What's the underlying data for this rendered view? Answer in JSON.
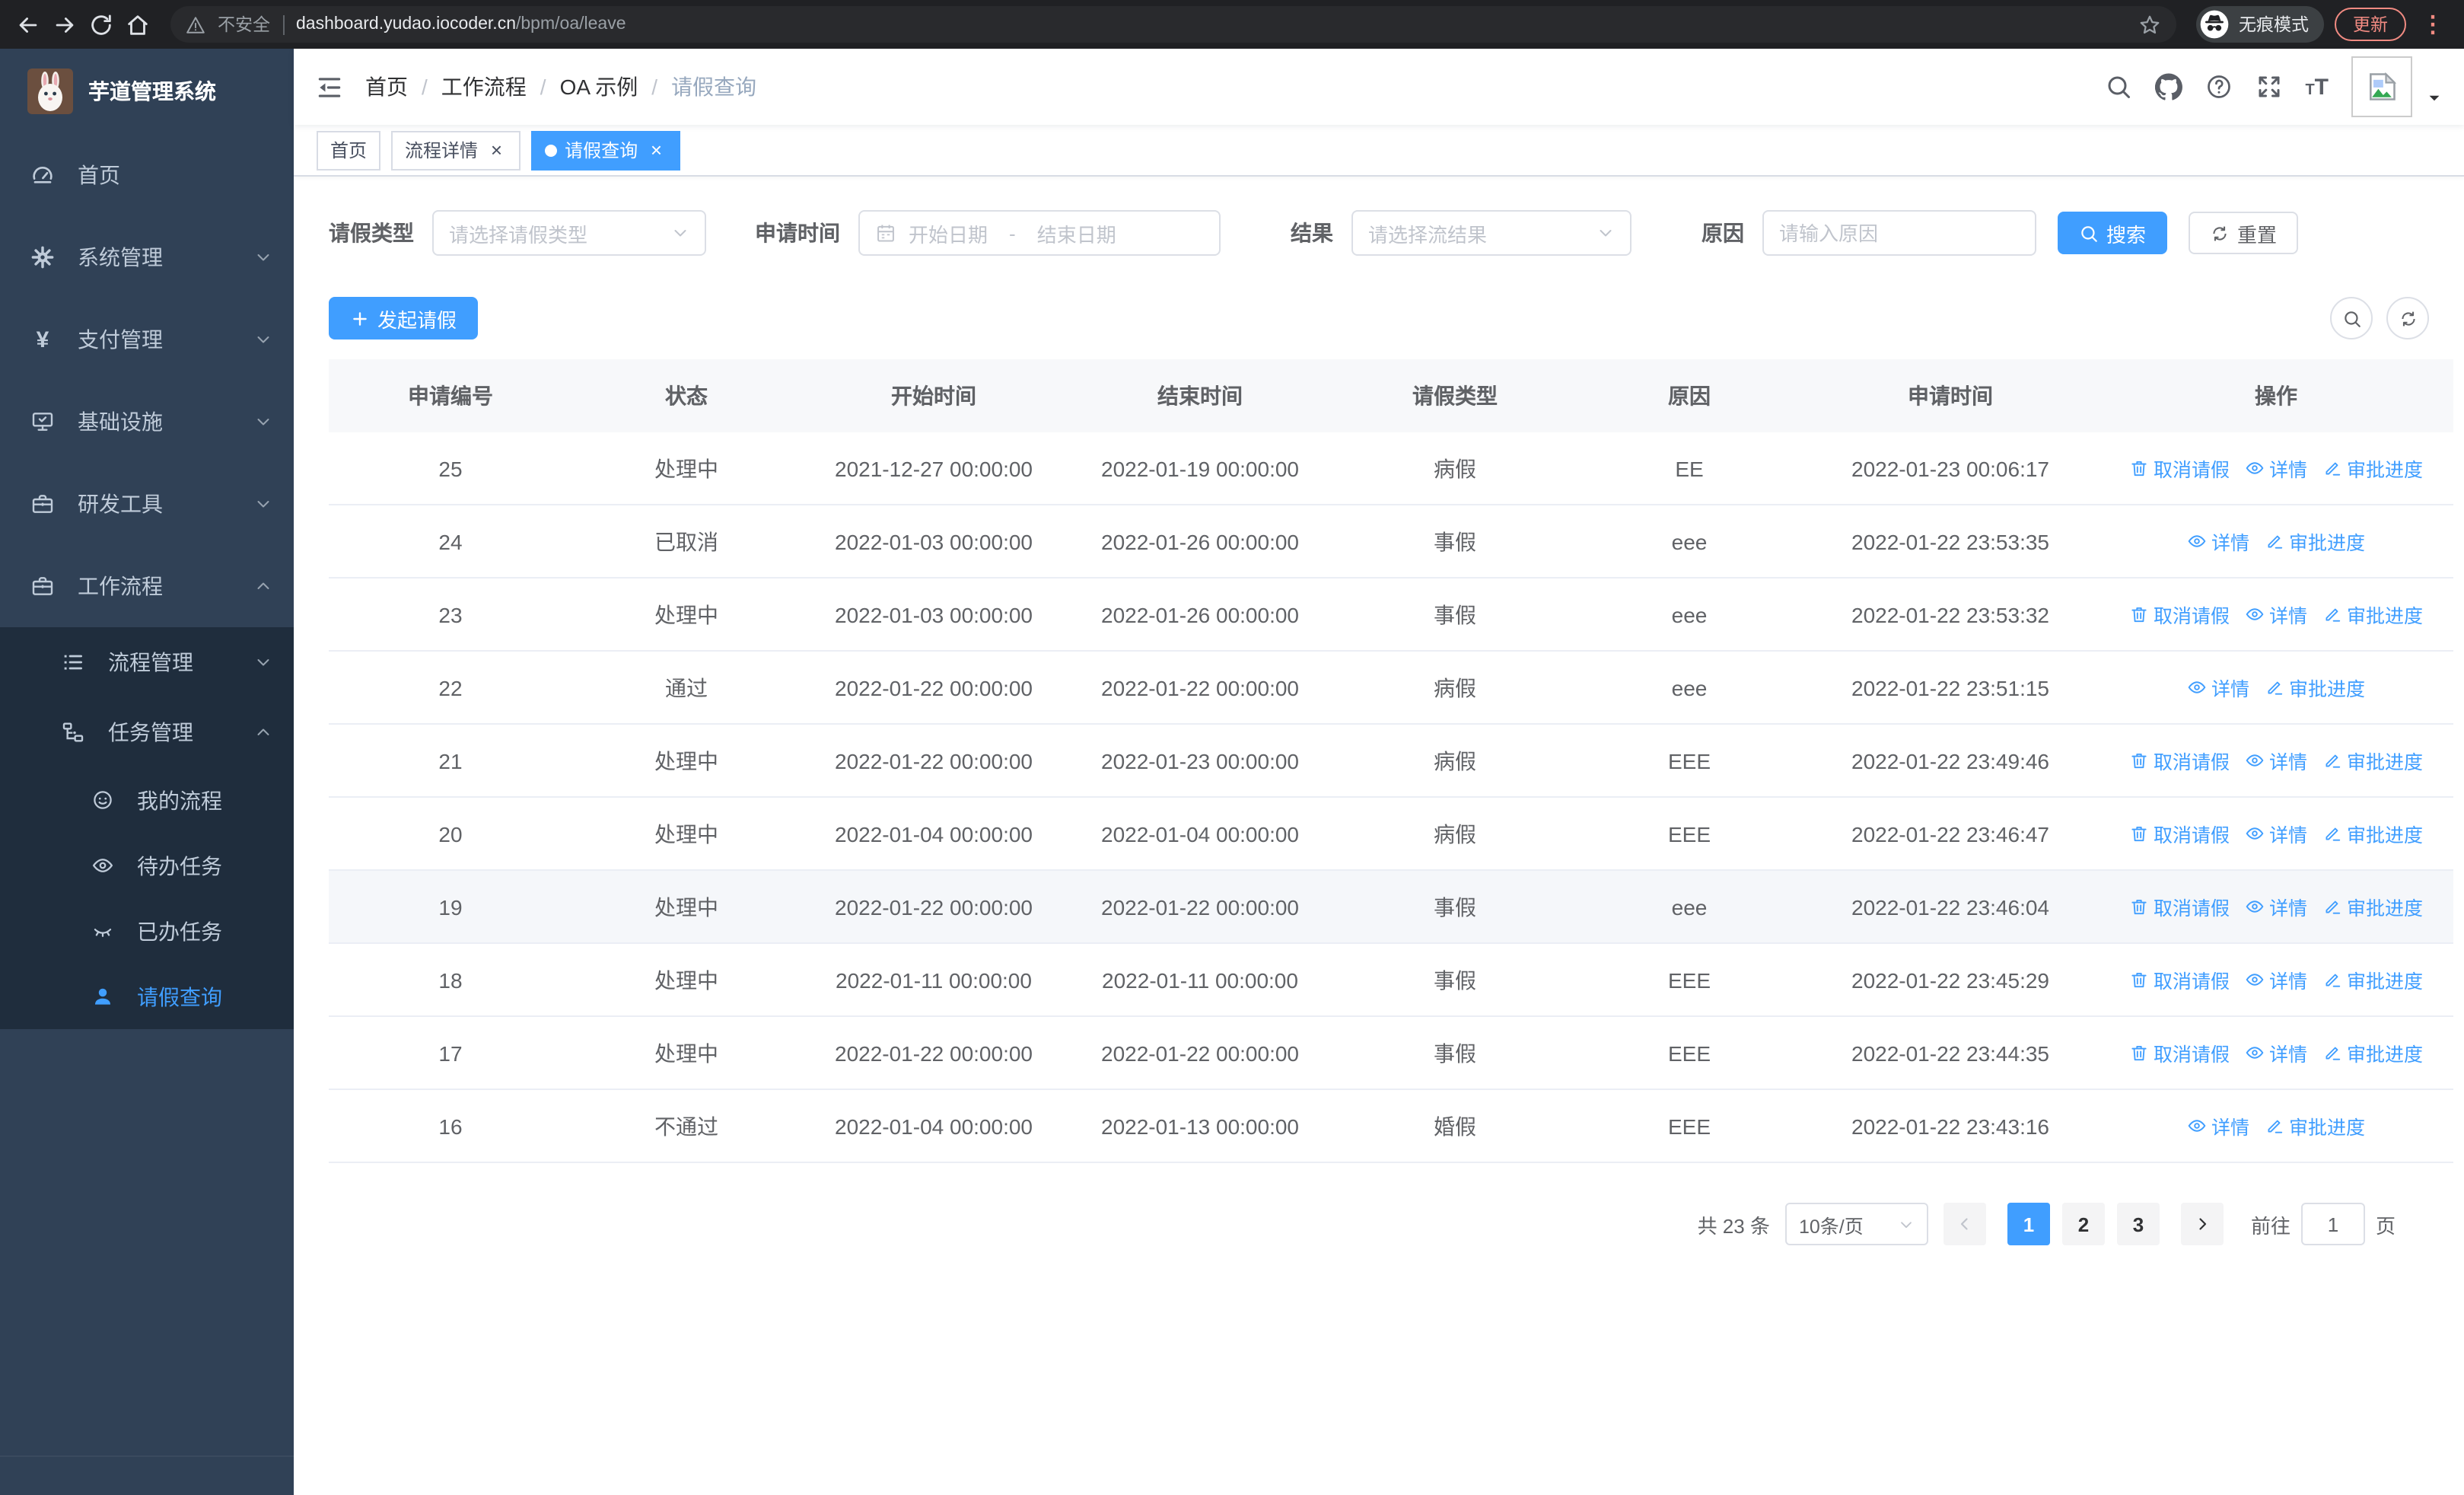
{
  "colors": {
    "accent": "#409eff",
    "sidebar_bg": "#304156",
    "submenu_bg": "#1f2d3d",
    "update_red": "#f28b82"
  },
  "browser": {
    "security_warning": "不安全",
    "url_host": "dashboard.yudao.iocoder.cn",
    "url_path": "/bpm/oa/leave",
    "incognito_label": "无痕模式",
    "update_label": "更新"
  },
  "sidebar": {
    "app_title": "芋道管理系统",
    "items": [
      {
        "label": "首页"
      },
      {
        "label": "系统管理"
      },
      {
        "label": "支付管理"
      },
      {
        "label": "基础设施"
      },
      {
        "label": "研发工具"
      },
      {
        "label": "工作流程"
      }
    ],
    "sub_items": [
      {
        "label": "流程管理"
      },
      {
        "label": "任务管理"
      }
    ],
    "leaf_items": [
      {
        "label": "我的流程"
      },
      {
        "label": "待办任务"
      },
      {
        "label": "已办任务"
      },
      {
        "label": "请假查询"
      }
    ]
  },
  "navbar": {
    "breadcrumb": [
      "首页",
      "工作流程",
      "OA 示例",
      "请假查询"
    ]
  },
  "tabs": [
    {
      "label": "首页",
      "closable": false,
      "active": false
    },
    {
      "label": "流程详情",
      "closable": true,
      "active": false
    },
    {
      "label": "请假查询",
      "closable": true,
      "active": true
    }
  ],
  "filters": {
    "leave_type_label": "请假类型",
    "leave_type_placeholder": "请选择请假类型",
    "apply_time_label": "申请时间",
    "start_date_placeholder": "开始日期",
    "range_separator": "-",
    "end_date_placeholder": "结束日期",
    "result_label": "结果",
    "result_placeholder": "请选择流结果",
    "reason_label": "原因",
    "reason_placeholder": "请输入原因",
    "search_button": "搜索",
    "reset_button": "重置"
  },
  "toolbar": {
    "create_button": "发起请假"
  },
  "table": {
    "columns": [
      "申请编号",
      "状态",
      "开始时间",
      "结束时间",
      "请假类型",
      "原因",
      "申请时间",
      "操作"
    ],
    "action_labels": {
      "cancel": "取消请假",
      "detail": "详情",
      "progress": "审批进度"
    },
    "rows": [
      {
        "id": "25",
        "status": "处理中",
        "start": "2021-12-27 00:00:00",
        "end": "2022-01-19 00:00:00",
        "type": "病假",
        "reason": "EE",
        "applied": "2022-01-23 00:06:17",
        "cancelable": true
      },
      {
        "id": "24",
        "status": "已取消",
        "start": "2022-01-03 00:00:00",
        "end": "2022-01-26 00:00:00",
        "type": "事假",
        "reason": "eee",
        "applied": "2022-01-22 23:53:35",
        "cancelable": false
      },
      {
        "id": "23",
        "status": "处理中",
        "start": "2022-01-03 00:00:00",
        "end": "2022-01-26 00:00:00",
        "type": "事假",
        "reason": "eee",
        "applied": "2022-01-22 23:53:32",
        "cancelable": true
      },
      {
        "id": "22",
        "status": "通过",
        "start": "2022-01-22 00:00:00",
        "end": "2022-01-22 00:00:00",
        "type": "病假",
        "reason": "eee",
        "applied": "2022-01-22 23:51:15",
        "cancelable": false
      },
      {
        "id": "21",
        "status": "处理中",
        "start": "2022-01-22 00:00:00",
        "end": "2022-01-23 00:00:00",
        "type": "病假",
        "reason": "EEE",
        "applied": "2022-01-22 23:49:46",
        "cancelable": true
      },
      {
        "id": "20",
        "status": "处理中",
        "start": "2022-01-04 00:00:00",
        "end": "2022-01-04 00:00:00",
        "type": "病假",
        "reason": "EEE",
        "applied": "2022-01-22 23:46:47",
        "cancelable": true
      },
      {
        "id": "19",
        "status": "处理中",
        "start": "2022-01-22 00:00:00",
        "end": "2022-01-22 00:00:00",
        "type": "事假",
        "reason": "eee",
        "applied": "2022-01-22 23:46:04",
        "cancelable": true,
        "highlighted": true
      },
      {
        "id": "18",
        "status": "处理中",
        "start": "2022-01-11 00:00:00",
        "end": "2022-01-11 00:00:00",
        "type": "事假",
        "reason": "EEE",
        "applied": "2022-01-22 23:45:29",
        "cancelable": true
      },
      {
        "id": "17",
        "status": "处理中",
        "start": "2022-01-22 00:00:00",
        "end": "2022-01-22 00:00:00",
        "type": "事假",
        "reason": "EEE",
        "applied": "2022-01-22 23:44:35",
        "cancelable": true
      },
      {
        "id": "16",
        "status": "不通过",
        "start": "2022-01-04 00:00:00",
        "end": "2022-01-13 00:00:00",
        "type": "婚假",
        "reason": "EEE",
        "applied": "2022-01-22 23:43:16",
        "cancelable": false
      }
    ]
  },
  "pagination": {
    "total_text": "共 23 条",
    "page_size": "10条/页",
    "pages": [
      "1",
      "2",
      "3"
    ],
    "active_page": "1",
    "goto_label": "前往",
    "goto_value": "1",
    "page_suffix": "页"
  }
}
